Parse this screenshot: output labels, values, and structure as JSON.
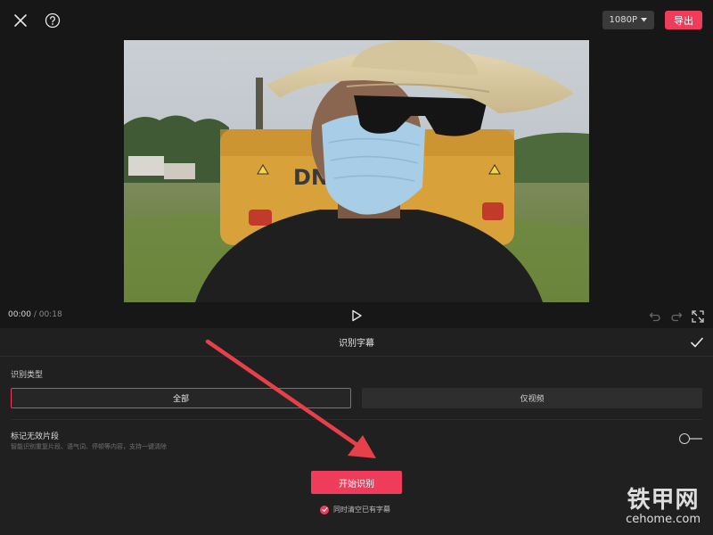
{
  "topbar": {
    "resolution_label": "1080P",
    "export_label": "导出"
  },
  "player": {
    "current_time": "00:00",
    "separator": "/",
    "total_time": "00:18"
  },
  "panel": {
    "title": "识别字幕",
    "type_label": "识别类型",
    "options": [
      {
        "label": "全部",
        "selected": true
      },
      {
        "label": "仅视频",
        "selected": false
      }
    ],
    "mark_invalid_title": "标记无效片段",
    "mark_invalid_desc": "智能识别重复片段、语气词、停顿等内容，支持一键清除",
    "mark_invalid_enabled": false,
    "start_label": "开始识别",
    "clear_existing_label": "同时清空已有字幕",
    "clear_existing_checked": true
  },
  "colors": {
    "accent": "#f03c5b",
    "background": "#171717",
    "panel": "#202020"
  },
  "watermark": {
    "cn": "铁甲网",
    "en": "cehome.com"
  }
}
